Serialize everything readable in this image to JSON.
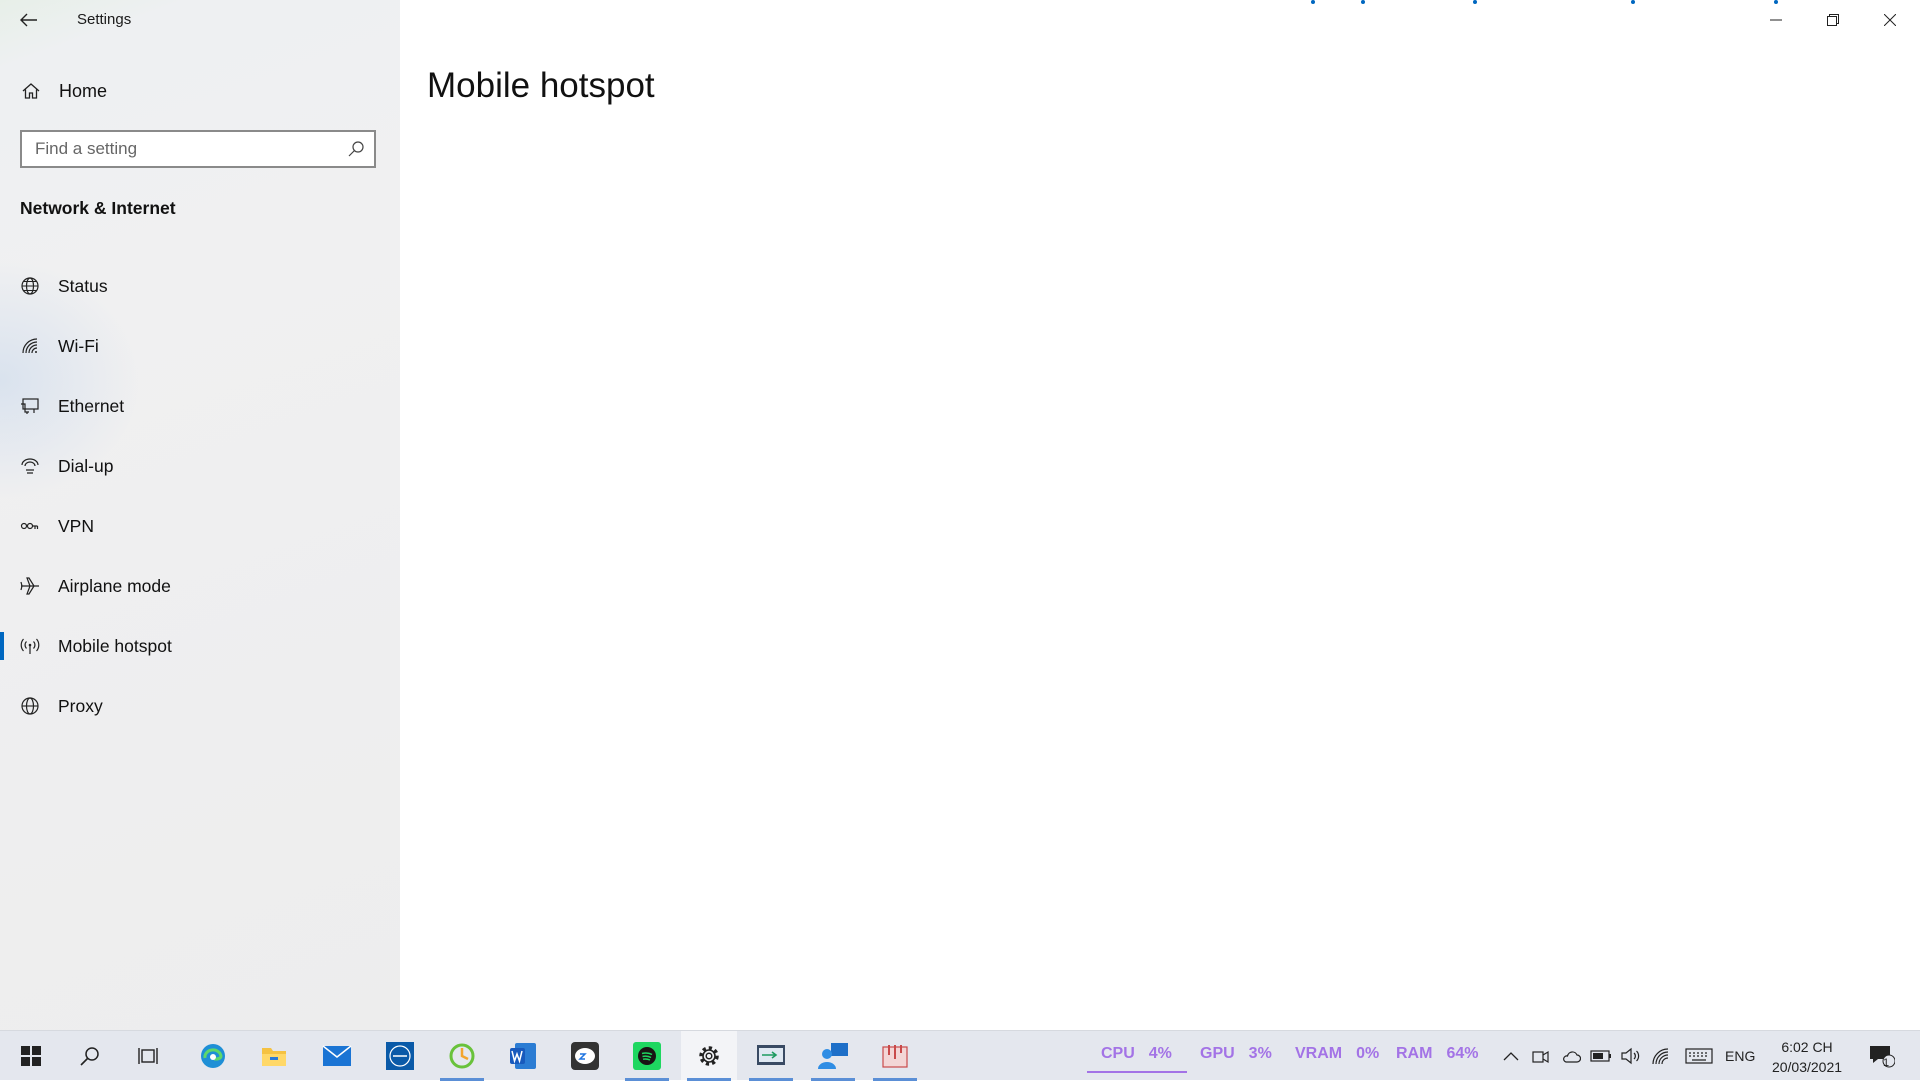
{
  "window": {
    "title": "Settings",
    "page_title": "Mobile hotspot"
  },
  "sidebar": {
    "home_label": "Home",
    "search_placeholder": "Find a setting",
    "section_title": "Network & Internet",
    "items": [
      {
        "label": "Status",
        "icon": "globe-status-icon"
      },
      {
        "label": "Wi-Fi",
        "icon": "wifi-icon"
      },
      {
        "label": "Ethernet",
        "icon": "ethernet-icon"
      },
      {
        "label": "Dial-up",
        "icon": "dial-up-icon"
      },
      {
        "label": "VPN",
        "icon": "vpn-icon"
      },
      {
        "label": "Airplane mode",
        "icon": "airplane-icon"
      },
      {
        "label": "Mobile hotspot",
        "icon": "hotspot-icon",
        "selected": true
      },
      {
        "label": "Proxy",
        "icon": "globe-icon"
      }
    ]
  },
  "taskbar": {
    "apps": [
      "start",
      "search",
      "task-view",
      "edge",
      "file-explorer",
      "mail",
      "dell",
      "green-app",
      "word",
      "zalo",
      "spotify",
      "settings",
      "remote-app",
      "people-app",
      "snipping-app"
    ],
    "stats": {
      "cpu_label": "CPU",
      "cpu_value": "4%",
      "gpu_label": "GPU",
      "gpu_value": "3%",
      "vram_label": "VRAM",
      "vram_value": "0%",
      "ram_label": "RAM",
      "ram_value": "64%"
    },
    "language": "ENG",
    "time": "6:02 CH",
    "date": "20/03/2021",
    "notification_count": "1"
  },
  "colors": {
    "accent": "#0067c0",
    "stats": "#a373e6",
    "taskbar_bg": "#e4e7ee"
  }
}
